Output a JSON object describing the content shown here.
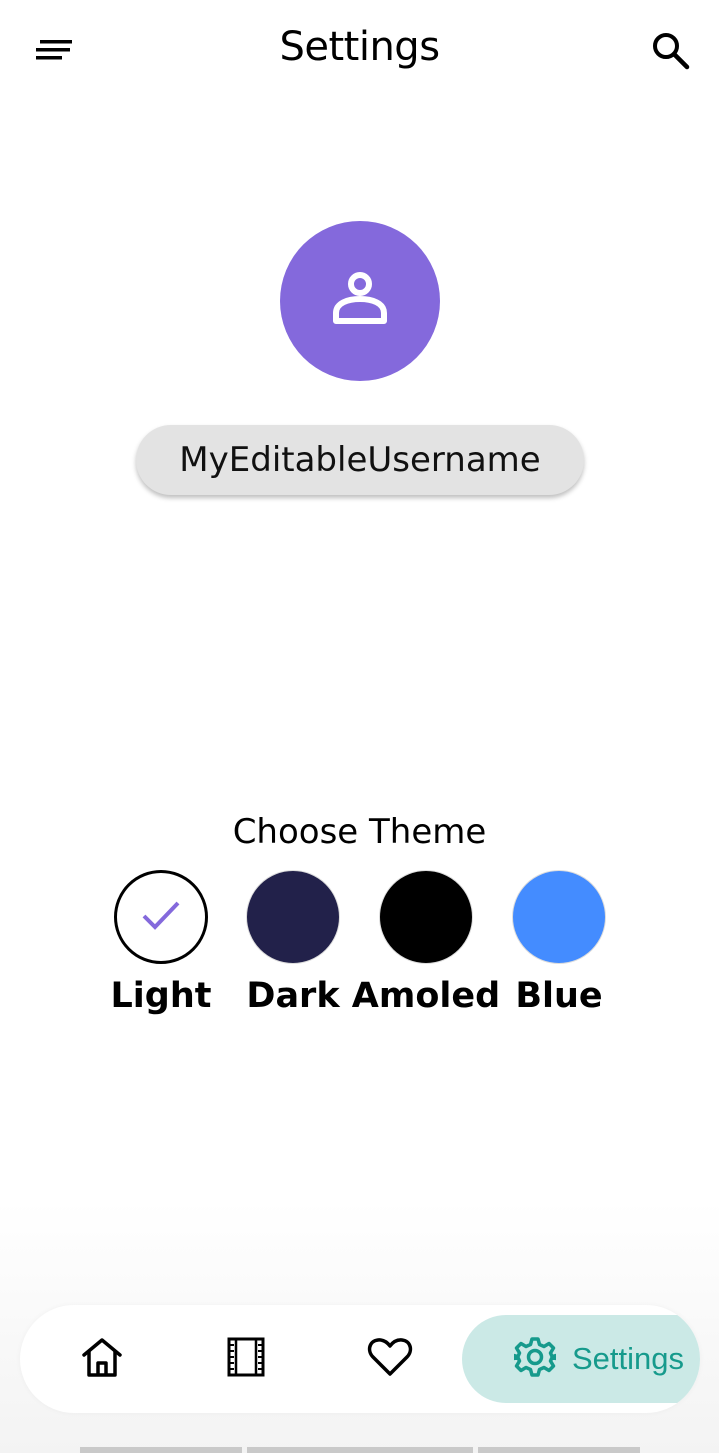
{
  "header": {
    "title": "Settings",
    "menu_icon": "menu-sort-icon",
    "search_icon": "search-icon"
  },
  "profile": {
    "avatar_icon": "person-icon",
    "avatar_color": "#8469dc",
    "username": "MyEditableUsername"
  },
  "theme": {
    "heading": "Choose Theme",
    "options": [
      {
        "label": "Light",
        "color": "#ffffff",
        "selected": true
      },
      {
        "label": "Dark",
        "color": "#22214a",
        "selected": false
      },
      {
        "label": "Amoled",
        "color": "#000000",
        "selected": false
      },
      {
        "label": "Blue",
        "color": "#448cff",
        "selected": false
      }
    ],
    "check_color": "#8469dc"
  },
  "bottom_nav": {
    "items": [
      {
        "icon": "home-icon"
      },
      {
        "icon": "film-icon"
      },
      {
        "icon": "heart-icon"
      },
      {
        "icon": "gear-icon",
        "label": "Settings",
        "active": true
      }
    ],
    "active_color": "#169a8c",
    "active_bg": "#cbe9e6"
  }
}
